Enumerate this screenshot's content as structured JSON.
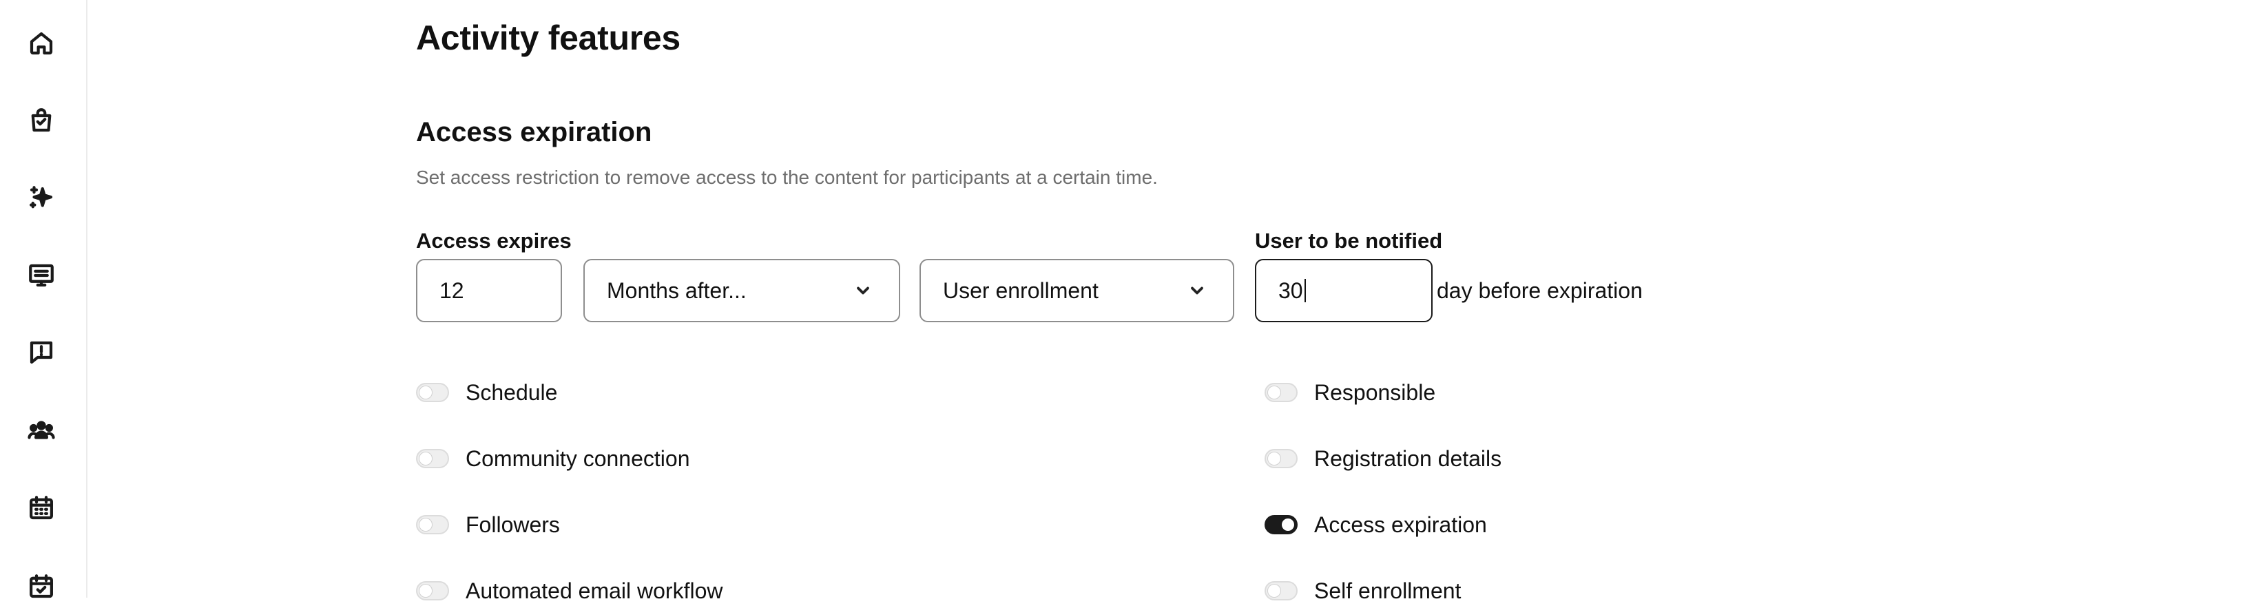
{
  "sidebar": {
    "items": [
      {
        "icon": "home-icon"
      },
      {
        "icon": "shopping-bag-icon"
      },
      {
        "icon": "sparkles-icon"
      },
      {
        "icon": "presentation-icon"
      },
      {
        "icon": "message-alert-icon"
      },
      {
        "icon": "users-group-icon"
      },
      {
        "icon": "calendar-icon"
      },
      {
        "icon": "calendar-check-icon"
      }
    ]
  },
  "page": {
    "title": "Activity features"
  },
  "access_expiration": {
    "title": "Access expiration",
    "description": "Set access restriction to remove access to the content for participants at a certain time.",
    "expires_label": "Access expires",
    "expires_value": "12",
    "period_select": "Months after...",
    "trigger_select": "User enrollment",
    "notify_label": "User to be notified",
    "notify_value": "30",
    "notify_suffix": "day before expiration"
  },
  "features": {
    "left": [
      {
        "label": "Schedule",
        "enabled": false
      },
      {
        "label": "Community connection",
        "enabled": false
      },
      {
        "label": "Followers",
        "enabled": false
      },
      {
        "label": "Automated email workflow",
        "enabled": false
      }
    ],
    "right": [
      {
        "label": "Responsible",
        "enabled": false
      },
      {
        "label": "Registration details",
        "enabled": false
      },
      {
        "label": "Access expiration",
        "enabled": true
      },
      {
        "label": "Self enrollment",
        "enabled": false
      }
    ]
  },
  "colors": {
    "toggle_on": "#1b1b1b",
    "toggle_off": "#efefef",
    "description_text": "#6e6e6e"
  }
}
